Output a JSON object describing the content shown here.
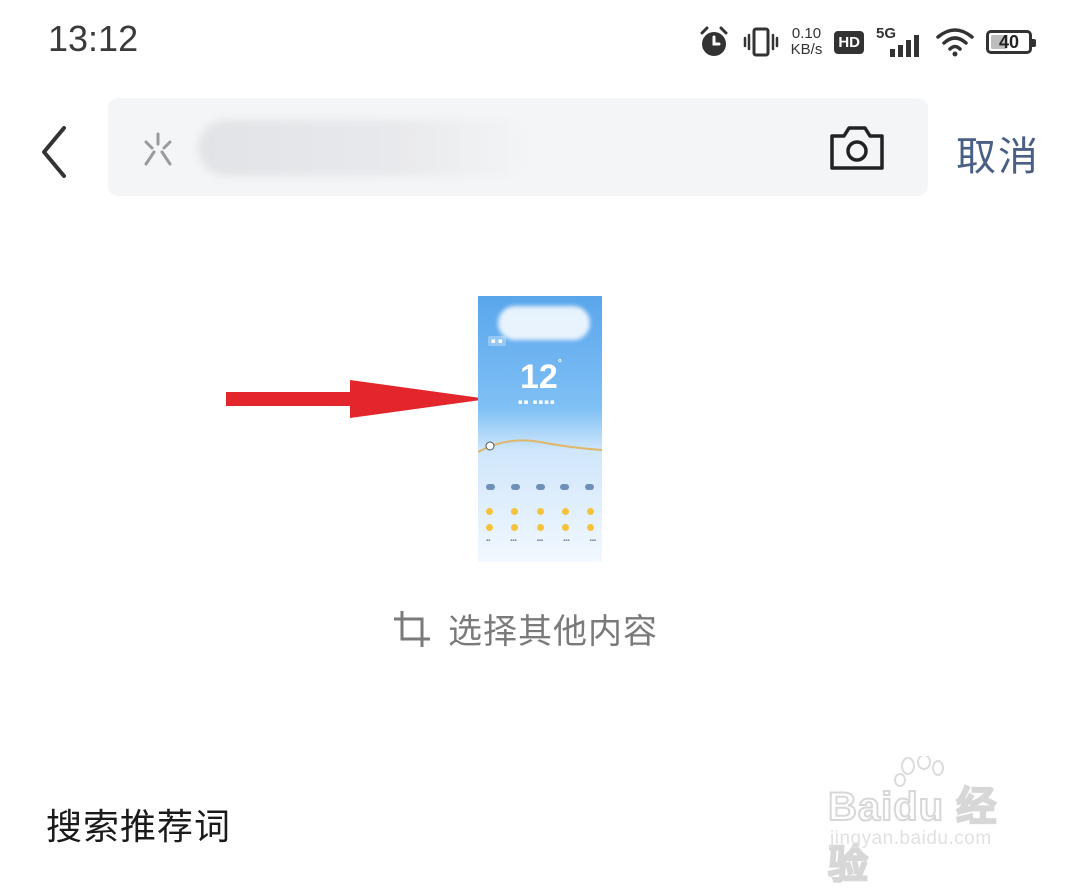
{
  "status_bar": {
    "time": "13:12",
    "net_speed_value": "0.10",
    "net_speed_unit": "KB/s",
    "hd_label": "HD",
    "network_type": "5G",
    "battery_level": "40"
  },
  "search_bar": {
    "back_icon": "chevron-left-icon",
    "logo_icon": "baidu-logo-icon",
    "camera_icon": "camera-icon",
    "cancel_label": "取消"
  },
  "preview": {
    "temperature": "12",
    "select_other_label": "选择其他内容",
    "crop_icon": "crop-icon",
    "arrow_color": "#e3262b"
  },
  "suggestions": {
    "title": "搜索推荐词"
  },
  "watermark": {
    "brand": "Baidu 经验",
    "url": "jingyan.baidu.com"
  },
  "colors": {
    "accent": "#4a5f85",
    "secondary_text": "#7a7a7a",
    "search_bg": "#f4f5f7"
  }
}
